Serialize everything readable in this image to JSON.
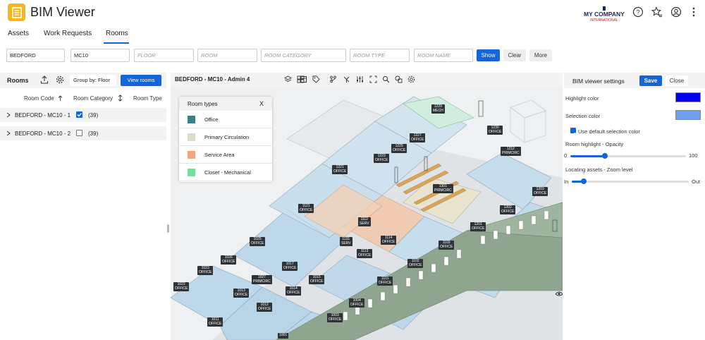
{
  "app": {
    "title": "BIM Viewer",
    "brand": "MY COMPANY",
    "brand_sub": "INTERNATIONAL"
  },
  "tabs": [
    {
      "label": "Assets"
    },
    {
      "label": "Work Requests"
    },
    {
      "label": "Rooms",
      "active": true
    }
  ],
  "filters": {
    "building": "BEDFORD",
    "site": "MC10",
    "floor_placeholder": "FLOOR",
    "room_placeholder": "ROOM",
    "room_category_placeholder": "ROOM CATEGORY",
    "room_type_placeholder": "ROOM TYPE",
    "room_name_placeholder": "ROOM NAME",
    "show_label": "Show",
    "clear_label": "Clear",
    "more_label": "More"
  },
  "rooms_panel": {
    "title": "Rooms",
    "group_by_label": "Group by: Floor",
    "view_rooms_label": "View rooms",
    "columns": [
      "Room Code",
      "Room Category",
      "Room Type"
    ],
    "rows": [
      {
        "label": "BEDFORD - MC10 - 1",
        "checked": true,
        "count": "(39)"
      },
      {
        "label": "BEDFORD - MC10 - 2",
        "checked": false,
        "count": "(39)"
      }
    ]
  },
  "viewer": {
    "title": "BEDFORD - MC10 - Admin 4",
    "toolbar_icons": [
      "cube-icon",
      "layers-icon",
      "grid-icon",
      "tag-icon",
      "branch-icon",
      "pin-icon",
      "sliders-icon",
      "fit-icon",
      "search-icon",
      "shapes-icon",
      "settings-icon"
    ]
  },
  "legend": {
    "title": "Room types",
    "close": "X",
    "items": [
      {
        "label": "Office",
        "color": "#3d7f86"
      },
      {
        "label": "Primary Circulation",
        "color": "#deddc4"
      },
      {
        "label": "Service Area",
        "color": "#f2a57c"
      },
      {
        "label": "Closet - Mechanical",
        "color": "#6fe39b"
      }
    ]
  },
  "room_tags": [
    {
      "code": "1229",
      "type": "MECH"
    },
    {
      "code": "1230",
      "type": "OFFICE"
    },
    {
      "code": "1227",
      "type": "OFFICE"
    },
    {
      "code": "1225",
      "type": "OFFICE"
    },
    {
      "code": "1223",
      "type": "OFFICE"
    },
    {
      "code": "1212",
      "type": "PRIMCIRC"
    },
    {
      "code": "1221",
      "type": "OFFICE"
    },
    {
      "code": "1301",
      "type": "PRIMCIRC"
    },
    {
      "code": "1203",
      "type": "OFFICE"
    },
    {
      "code": "1202",
      "type": "OFFICE"
    },
    {
      "code": "1121",
      "type": "OFFICE"
    },
    {
      "code": "1112",
      "type": "SERV"
    },
    {
      "code": "1201",
      "type": "OFFICE"
    },
    {
      "code": "1025",
      "type": "OFFICE"
    },
    {
      "code": "1131",
      "type": "SERV"
    },
    {
      "code": "1114",
      "type": "OFFICE"
    },
    {
      "code": "1103",
      "type": "OFFICE"
    },
    {
      "code": "1113",
      "type": "OFFICE"
    },
    {
      "code": "1026",
      "type": "OFFICE"
    },
    {
      "code": "1102",
      "type": "OFFICE"
    },
    {
      "code": "1023",
      "type": "OFFICE"
    },
    {
      "code": "1027",
      "type": "PRIMCIRC"
    },
    {
      "code": "1017",
      "type": "OFFICE"
    },
    {
      "code": "1015",
      "type": "OFFICE"
    },
    {
      "code": "1101",
      "type": "OFFICE"
    },
    {
      "code": "1022",
      "type": "OFFICE"
    },
    {
      "code": "1013",
      "type": "OFFICE"
    },
    {
      "code": "1014",
      "type": "OFFICE"
    },
    {
      "code": "1012",
      "type": "OFFICE"
    },
    {
      "code": "1004",
      "type": "OFFICE"
    },
    {
      "code": "1003",
      "type": "OFFICE"
    },
    {
      "code": "1011",
      "type": "OFFICE"
    },
    {
      "code": "1001",
      "type": ""
    }
  ],
  "settings": {
    "title": "BIM viewer settings",
    "save_label": "Save",
    "close_label": "Close",
    "highlight_color_label": "Highlight color",
    "highlight_color": "#0000ee",
    "selection_color_label": "Selection color",
    "selection_color": "#6f9ff0",
    "use_default_label": "Use default selection color",
    "use_default_checked": true,
    "opacity_label": "Room highlight - Opacity",
    "opacity_min": "0",
    "opacity_max": "100",
    "opacity_value": 30,
    "zoom_label": "Locating assets - Zoom level",
    "zoom_min": "In",
    "zoom_max": "Out",
    "zoom_value": 10
  }
}
